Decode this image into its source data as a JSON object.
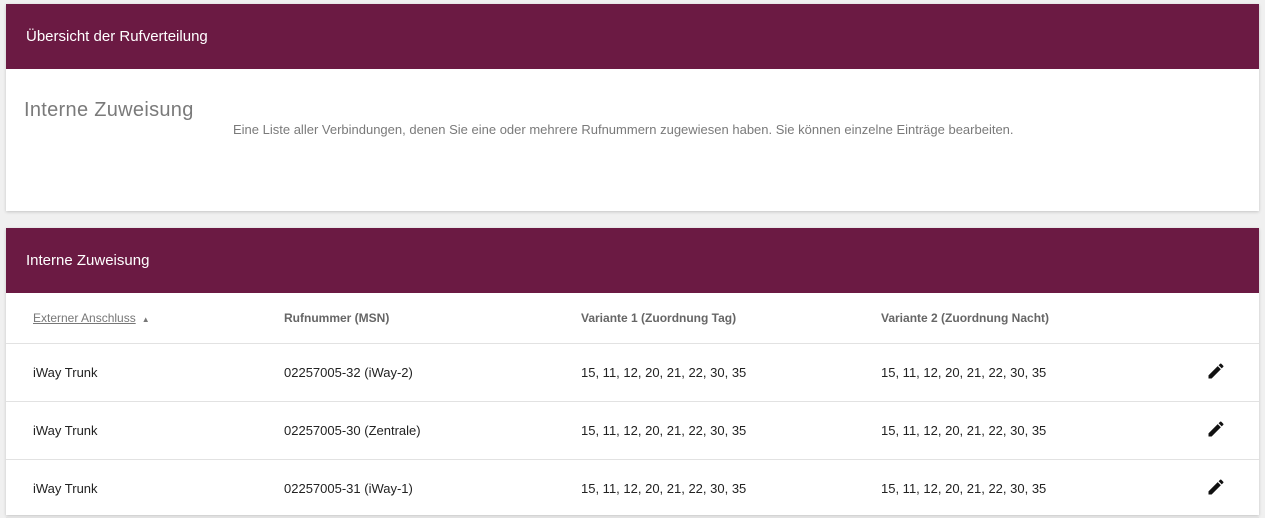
{
  "overview": {
    "header": "Übersicht der Rufverteilung",
    "heading": "Interne Zuweisung",
    "description": "Eine Liste aller Verbindungen, denen Sie eine oder mehrere Rufnummern zugewiesen haben. Sie können einzelne Einträge bearbeiten."
  },
  "table_panel": {
    "header": "Interne Zuweisung",
    "columns": {
      "external": "Externer Anschluss",
      "number": "Rufnummer (MSN)",
      "variant1": "Variante 1 (Zuordnung Tag)",
      "variant2": "Variante 2 (Zuordnung Nacht)"
    },
    "sort_arrow": "▲",
    "sort_column": "external",
    "rows": [
      {
        "external": "iWay Trunk",
        "number": "02257005-32 (iWay-2)",
        "variant1": "15, 11, 12, 20, 21, 22, 30, 35",
        "variant2": "15, 11, 12, 20, 21, 22, 30, 35",
        "action_icon": "pencil-icon"
      },
      {
        "external": "iWay Trunk",
        "number": "02257005-30 (Zentrale)",
        "variant1": "15, 11, 12, 20, 21, 22, 30, 35",
        "variant2": "15, 11, 12, 20, 21, 22, 30, 35",
        "action_icon": "pencil-icon"
      },
      {
        "external": "iWay Trunk",
        "number": "02257005-31 (iWay-1)",
        "variant1": "15, 11, 12, 20, 21, 22, 30, 35",
        "variant2": "15, 11, 12, 20, 21, 22, 30, 35",
        "action_icon": "pencil-icon"
      }
    ]
  },
  "colors": {
    "header_bg": "#6b1a43",
    "header_text": "#ffffff"
  }
}
